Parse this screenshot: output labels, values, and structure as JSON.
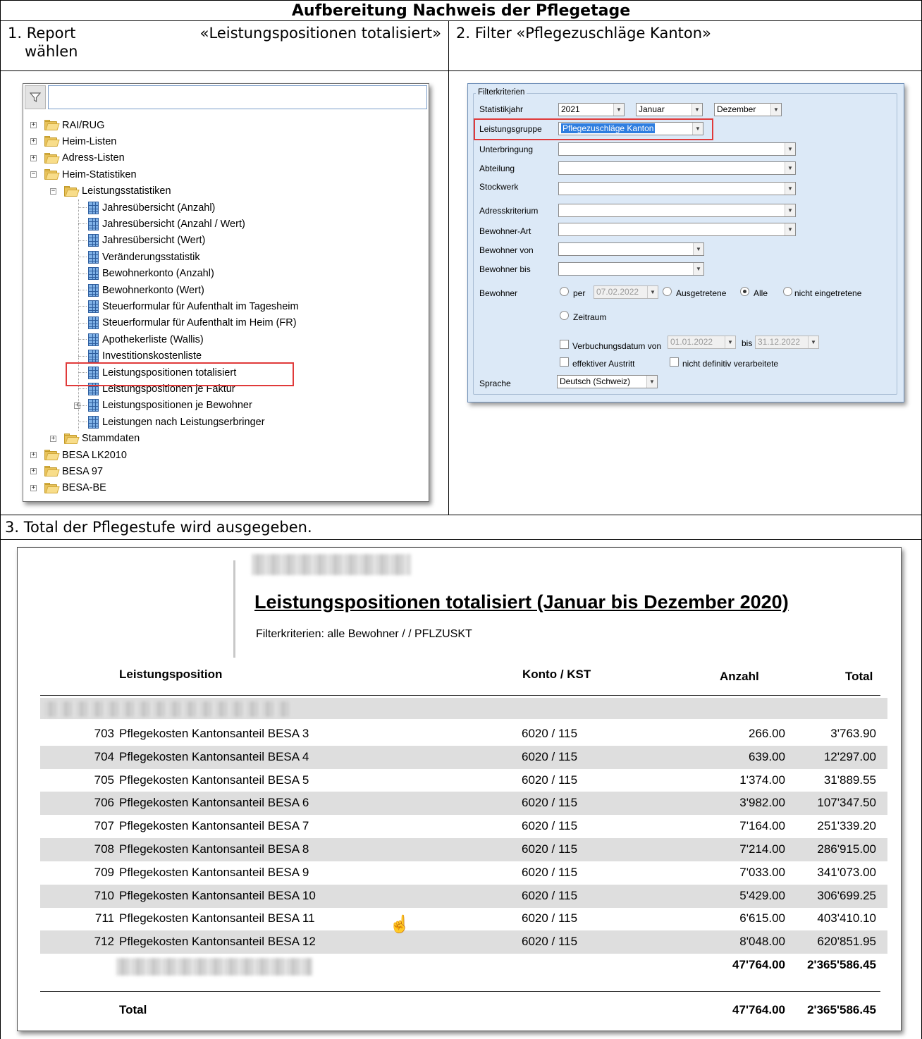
{
  "document": {
    "title": "Aufbereitung Nachweis der Pflegetage",
    "step1_line1_left": "1. Report",
    "step1_line1_right": "«Leistungspositionen totalisiert»",
    "step1_line2": "wählen",
    "step2": "2. Filter «Pflegezuschläge Kanton»",
    "step3": "3. Total der Pflegestufe wird ausgegeben."
  },
  "tree": {
    "search_value": "",
    "items": [
      {
        "label": "RAI/RUG",
        "icon": "folder-icon",
        "level": 0,
        "expander": "+"
      },
      {
        "label": "Heim-Listen",
        "icon": "folder-icon",
        "level": 0,
        "expander": "+"
      },
      {
        "label": "Adress-Listen",
        "icon": "folder-icon",
        "level": 0,
        "expander": "+"
      },
      {
        "label": "Heim-Statistiken",
        "icon": "folder-icon",
        "level": 0,
        "expander": "−"
      },
      {
        "label": "Leistungsstatistiken",
        "icon": "folder-icon",
        "level": 1,
        "expander": "−"
      },
      {
        "label": "Jahresübersicht (Anzahl)",
        "icon": "report-icon",
        "level": 2,
        "expander": ""
      },
      {
        "label": "Jahresübersicht (Anzahl / Wert)",
        "icon": "report-icon",
        "level": 2,
        "expander": ""
      },
      {
        "label": "Jahresübersicht (Wert)",
        "icon": "report-icon",
        "level": 2,
        "expander": ""
      },
      {
        "label": "Veränderungsstatistik",
        "icon": "report-icon",
        "level": 2,
        "expander": ""
      },
      {
        "label": "Bewohnerkonto (Anzahl)",
        "icon": "report-icon",
        "level": 2,
        "expander": ""
      },
      {
        "label": "Bewohnerkonto (Wert)",
        "icon": "report-icon",
        "level": 2,
        "expander": ""
      },
      {
        "label": "Steuerformular für Aufenthalt im Tagesheim",
        "icon": "report-icon",
        "level": 2,
        "expander": ""
      },
      {
        "label": "Steuerformular für Aufenthalt im Heim (FR)",
        "icon": "report-icon",
        "level": 2,
        "expander": ""
      },
      {
        "label": "Apothekerliste (Wallis)",
        "icon": "report-icon",
        "level": 2,
        "expander": ""
      },
      {
        "label": "Investitionskostenliste",
        "icon": "report-icon",
        "level": 2,
        "expander": ""
      },
      {
        "label": "Leistungspositionen totalisiert",
        "icon": "report-icon",
        "level": 2,
        "expander": "",
        "highlighted": true
      },
      {
        "label": "Leistungspositionen je Faktur",
        "icon": "report-icon",
        "level": 2,
        "expander": ""
      },
      {
        "label": "Leistungspositionen je Bewohner",
        "icon": "report-icon",
        "level": 2,
        "expander": "+"
      },
      {
        "label": "Leistungen nach Leistungserbringer",
        "icon": "report-icon",
        "level": 2,
        "expander": ""
      },
      {
        "label": "Stammdaten",
        "icon": "folder-icon",
        "level": 1,
        "expander": "+"
      },
      {
        "label": "BESA LK2010",
        "icon": "folder-icon",
        "level": 0,
        "expander": "+"
      },
      {
        "label": "BESA 97",
        "icon": "folder-icon",
        "level": 0,
        "expander": "+"
      },
      {
        "label": "BESA-BE",
        "icon": "folder-icon",
        "level": 0,
        "expander": "+"
      }
    ]
  },
  "filter": {
    "group_title": "Filterkriterien",
    "statistikjahr_label": "Statistikjahr",
    "year": "2021",
    "month_from": "Januar",
    "month_to": "Dezember",
    "leistungsgruppe_label": "Leistungsgruppe",
    "leistungsgruppe_value": "Pflegezuschläge Kanton",
    "unterbringung_label": "Unterbringung",
    "abteilung_label": "Abteilung",
    "stockwerk_label": "Stockwerk",
    "adresskriterium_label": "Adresskriterium",
    "bewohner_art_label": "Bewohner-Art",
    "bewohner_von_label": "Bewohner von",
    "bewohner_bis_label": "Bewohner bis",
    "bewohner_label": "Bewohner",
    "radio_per": "per",
    "per_date": "07.02.2022",
    "radio_ausgetretene": "Ausgetretene",
    "radio_alle": "Alle",
    "radio_nicht_eingetretene": "nicht eingetretene",
    "radio_zeitraum": "Zeitraum",
    "verbuchungsdatum_label": "Verbuchungsdatum von",
    "verbuchung_von": "01.01.2022",
    "bis_label": "bis",
    "verbuchung_bis": "31.12.2022",
    "effektiver_austritt": "effektiver Austritt",
    "nicht_definitiv": "nicht definitiv verarbeitete",
    "sprache_label": "Sprache",
    "sprache_value": "Deutsch (Schweiz)"
  },
  "report": {
    "title": "Leistungspositionen totalisiert (Januar bis Dezember 2020)",
    "filter_text": "Filterkriterien: alle Bewohner / / PFLZUSKT",
    "headers": {
      "position": "Leistungsposition",
      "konto": "Konto / KST",
      "anzahl": "Anzahl",
      "total": "Total"
    },
    "rows": [
      {
        "code": "703",
        "name": "Pflegekosten Kantonsanteil BESA 3",
        "konto": "6020 / 115",
        "anzahl": "266.00",
        "total": "3'763.90"
      },
      {
        "code": "704",
        "name": "Pflegekosten Kantonsanteil BESA 4",
        "konto": "6020 / 115",
        "anzahl": "639.00",
        "total": "12'297.00"
      },
      {
        "code": "705",
        "name": "Pflegekosten Kantonsanteil BESA 5",
        "konto": "6020 / 115",
        "anzahl": "1'374.00",
        "total": "31'889.55"
      },
      {
        "code": "706",
        "name": "Pflegekosten Kantonsanteil BESA 6",
        "konto": "6020 / 115",
        "anzahl": "3'982.00",
        "total": "107'347.50"
      },
      {
        "code": "707",
        "name": "Pflegekosten Kantonsanteil BESA 7",
        "konto": "6020 / 115",
        "anzahl": "7'164.00",
        "total": "251'339.20"
      },
      {
        "code": "708",
        "name": "Pflegekosten Kantonsanteil BESA 8",
        "konto": "6020 / 115",
        "anzahl": "7'214.00",
        "total": "286'915.00"
      },
      {
        "code": "709",
        "name": "Pflegekosten Kantonsanteil BESA 9",
        "konto": "6020 / 115",
        "anzahl": "7'033.00",
        "total": "341'073.00"
      },
      {
        "code": "710",
        "name": "Pflegekosten Kantonsanteil BESA 10",
        "konto": "6020 / 115",
        "anzahl": "5'429.00",
        "total": "306'699.25"
      },
      {
        "code": "711",
        "name": "Pflegekosten Kantonsanteil BESA 11",
        "konto": "6020 / 115",
        "anzahl": "6'615.00",
        "total": "403'410.10"
      },
      {
        "code": "712",
        "name": "Pflegekosten Kantonsanteil BESA 12",
        "konto": "6020 / 115",
        "anzahl": "8'048.00",
        "total": "620'851.95"
      }
    ],
    "subtotal": {
      "anzahl": "47'764.00",
      "total": "2'365'586.45"
    },
    "grand_total": {
      "label": "Total",
      "anzahl": "47'764.00",
      "total": "2'365'586.45"
    }
  }
}
